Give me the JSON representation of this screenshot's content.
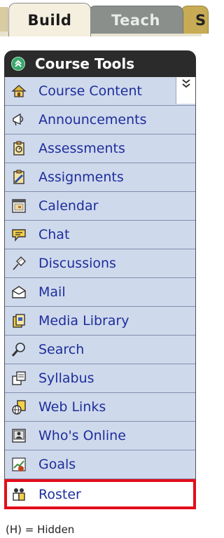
{
  "tabs": {
    "build_label": "Build",
    "teach_label": "Teach",
    "more_label": "S"
  },
  "panel": {
    "title": "Course Tools",
    "items": [
      {
        "label": "Course Content",
        "icon": "house-icon"
      },
      {
        "label": "Announcements",
        "icon": "megaphone-icon"
      },
      {
        "label": "Assessments",
        "icon": "clipboard-check-icon"
      },
      {
        "label": "Assignments",
        "icon": "clipboard-pencil-icon"
      },
      {
        "label": "Calendar",
        "icon": "calendar-icon"
      },
      {
        "label": "Chat",
        "icon": "speech-bubble-icon"
      },
      {
        "label": "Discussions",
        "icon": "pushpin-icon"
      },
      {
        "label": "Mail",
        "icon": "envelope-icon"
      },
      {
        "label": "Media Library",
        "icon": "media-library-icon"
      },
      {
        "label": "Search",
        "icon": "magnifier-icon"
      },
      {
        "label": "Syllabus",
        "icon": "syllabus-icon"
      },
      {
        "label": "Web Links",
        "icon": "globe-link-icon"
      },
      {
        "label": "Who's Online",
        "icon": "who-online-icon"
      },
      {
        "label": "Goals",
        "icon": "goals-icon"
      },
      {
        "label": "Roster",
        "icon": "roster-icon"
      }
    ],
    "selected_item": "Roster",
    "collapse_icon": "double-chevron-down-icon"
  },
  "legend": "(H) = Hidden",
  "colors": {
    "item_bg": "#cfd9ec",
    "link_text": "#1d2e9b",
    "header_bg": "#2b2b2b",
    "selection_border": "#e30d1c"
  }
}
